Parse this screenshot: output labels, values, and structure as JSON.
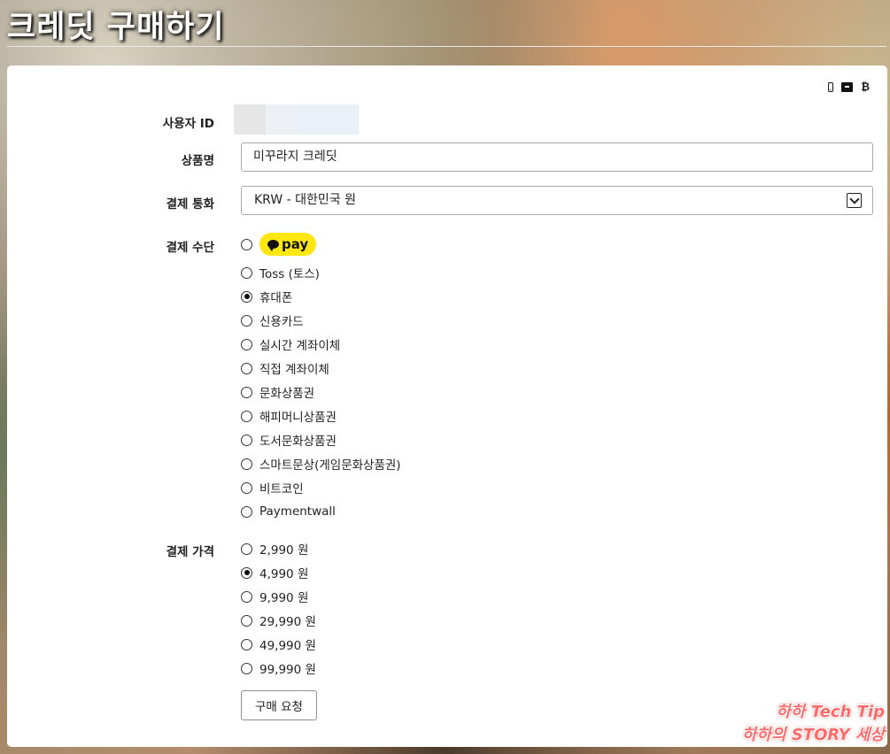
{
  "page": {
    "title": "크레딧 구매하기"
  },
  "form": {
    "user_id_label": "사용자 ID",
    "product_label": "상품명",
    "product_value": "미꾸라지 크레딧",
    "currency_label": "결제 통화",
    "currency_value": "KRW - 대한민국 원",
    "method_label": "결제 수단",
    "methods": [
      {
        "label": "pay",
        "checked": false
      },
      {
        "label": "Toss (토스)",
        "checked": false
      },
      {
        "label": "휴대폰",
        "checked": true
      },
      {
        "label": "신용카드",
        "checked": false
      },
      {
        "label": "실시간 계좌이체",
        "checked": false
      },
      {
        "label": "직접 계좌이체",
        "checked": false
      },
      {
        "label": "문화상품권",
        "checked": false
      },
      {
        "label": "해피머니상품권",
        "checked": false
      },
      {
        "label": "도서문화상품권",
        "checked": false
      },
      {
        "label": "스마트문상(게임문화상품권)",
        "checked": false
      },
      {
        "label": "비트코인",
        "checked": false
      },
      {
        "label": "Paymentwall",
        "checked": false
      }
    ],
    "price_label": "결제 가격",
    "prices": [
      {
        "label": "2,990 원",
        "checked": false
      },
      {
        "label": "4,990 원",
        "checked": true
      },
      {
        "label": "9,990 원",
        "checked": false
      },
      {
        "label": "29,990 원",
        "checked": false
      },
      {
        "label": "49,990 원",
        "checked": false
      },
      {
        "label": "99,990 원",
        "checked": false
      }
    ],
    "submit_label": "구매 요청"
  },
  "icons": [
    "mobile-icon",
    "card-icon",
    "bitcoin-icon"
  ],
  "colors": {
    "kakaopay_yellow": "#ffe812",
    "panel_bg": "#ffffff"
  },
  "watermark": {
    "line1": "하하 Tech Tip",
    "line2": "하하의 STORY 세상"
  }
}
